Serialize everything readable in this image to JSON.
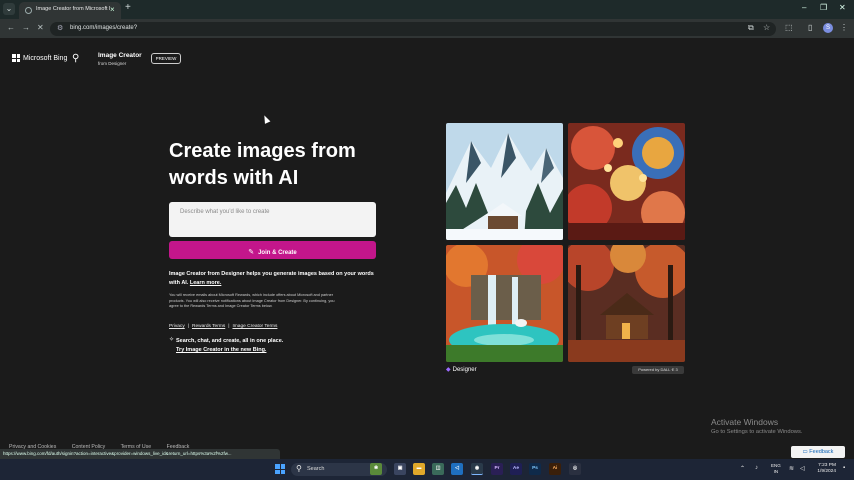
{
  "browser": {
    "tab_title": "Image Creator from Microsoft Designer",
    "new_tab_symbol": "+",
    "url": "bing.com/images/create?",
    "profile_initial": "S"
  },
  "header": {
    "brand": "Microsoft Bing",
    "product_title": "Image Creator",
    "product_subtitle": "from Designer",
    "preview_badge": "PREVIEW"
  },
  "hero": {
    "headline": "Create images from words with AI",
    "prompt_placeholder": "Describe what you'd like to create",
    "join_button": "Join & Create",
    "description": "Image Creator from Designer helps you generate images based on your words with AI.",
    "learn_more": "Learn more.",
    "fine_print": "You will receive emails about Microsoft Rewards, which include offers about Microsoft and partner products. You will also receive notifications about Image Creator from Designer. By continuing, you agree to the Rewards Terms and Image Creator Terms below.",
    "legal_links": [
      "Privacy",
      "Rewards Terms",
      "Image Creator Terms"
    ],
    "legal_separator": "|",
    "promo_text": "Search, chat, and create, all in one place.",
    "promo_link": "Try Image Creator in the new Bing."
  },
  "gallery": {
    "images": [
      "snowy-mountain-village",
      "colorful-swirl-lanterns",
      "waterfall-lagoon-unicorn",
      "autumn-forest-cabin"
    ],
    "designer_label": "Designer",
    "dalle_badge": "Powered by DALL·E 3"
  },
  "footer": {
    "links": [
      "Privacy and Cookies",
      "Content Policy",
      "Terms of Use",
      "Feedback"
    ],
    "feedback_button": "Feedback"
  },
  "watermark": {
    "title": "Activate Windows",
    "subtitle": "Go to Settings to activate Windows."
  },
  "status_bar_url": "https://www.bing.com/fd/auth/signin?action=interactive&provider=windows_live_id&return_url=https%3a%2f%2fw...",
  "taskbar": {
    "search_label": "Search",
    "apps": [
      "Pr",
      "Ae",
      "Ps",
      "Ai"
    ],
    "language_line1": "ENG",
    "language_line2": "IN",
    "time": "7:23 PM",
    "date": "1/9/2024"
  },
  "colors": {
    "accent": "#c3168b",
    "page_bg": "#1b1b1b",
    "taskbar_bg": "#1d2536"
  }
}
